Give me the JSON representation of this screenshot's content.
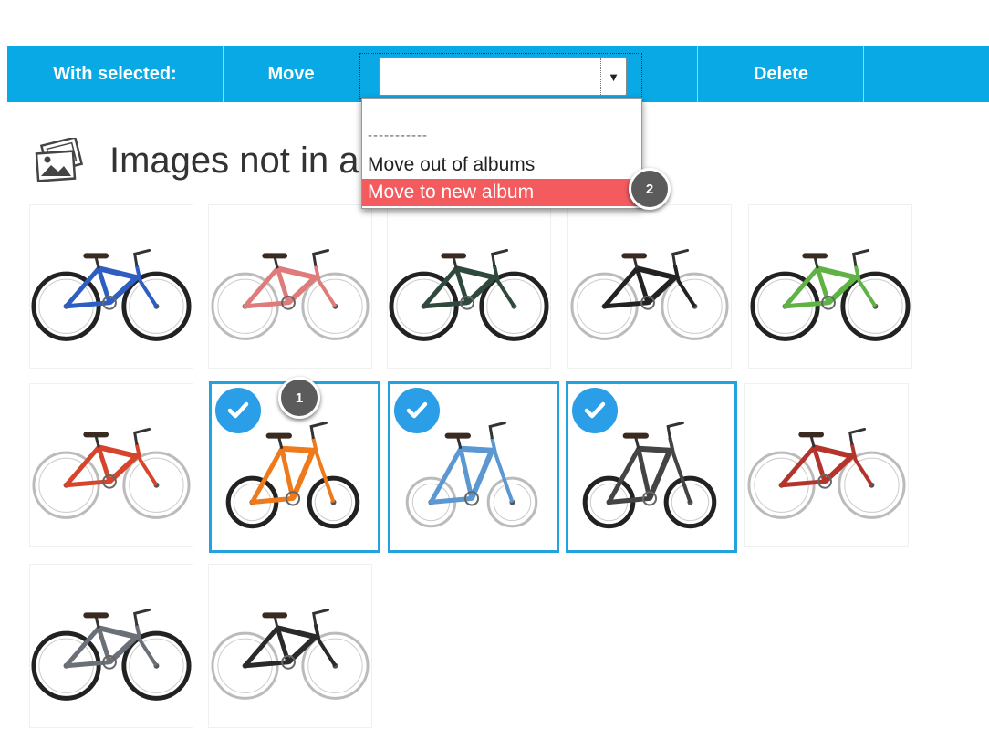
{
  "toolbar": {
    "with_selected_label": "With selected:",
    "move_label": "Move",
    "move_select_value": "",
    "delete_label": "Delete",
    "background_color": "#09a9e6"
  },
  "move_dropdown": {
    "options": [
      "-----------",
      "Move out of albums",
      "Move to new album"
    ],
    "highlighted_option": "Move to new album",
    "highlight_color": "#f35b5f"
  },
  "section": {
    "icon": "gallery-icon",
    "title": "Images not in a"
  },
  "callouts": [
    "1",
    "2"
  ],
  "images": [
    {
      "name": "blue-comfort-bike",
      "color": "#2f5ec2",
      "selected": false
    },
    {
      "name": "pink-fixie-bike",
      "color": "#e07b7b",
      "selected": false
    },
    {
      "name": "dark-green-city-bike",
      "color": "#2f4a3c",
      "selected": false
    },
    {
      "name": "black-mountain-bike",
      "color": "#222222",
      "selected": false
    },
    {
      "name": "green-full-suspension-bike",
      "color": "#5fb244",
      "selected": false
    },
    {
      "name": "red-mountain-bike",
      "color": "#d6452b",
      "selected": false
    },
    {
      "name": "orange-folding-bike",
      "color": "#ee7a1c",
      "selected": true
    },
    {
      "name": "blue-folding-bike",
      "color": "#5b97d1",
      "selected": true
    },
    {
      "name": "grey-folding-bike",
      "color": "#444444",
      "selected": true
    },
    {
      "name": "red-electric-bike",
      "color": "#b3342b",
      "selected": false
    },
    {
      "name": "grey-electric-bike",
      "color": "#6a6f78",
      "selected": false
    },
    {
      "name": "black-cruiser-electric-bike",
      "color": "#2a2a2a",
      "selected": false
    }
  ],
  "colors": {
    "selection_border": "#23a3dd",
    "check_badge": "#2a9ee6",
    "callout": "#5b5b5b"
  }
}
